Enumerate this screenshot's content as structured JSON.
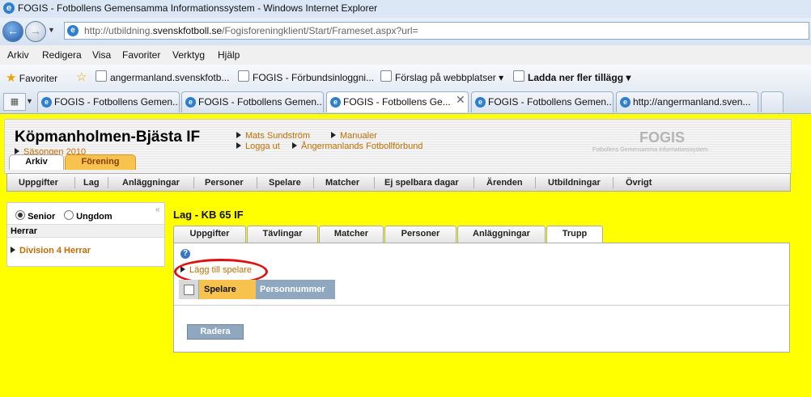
{
  "browser": {
    "title": "FOGIS - Fotbollens Gemensamma Informationssystem - Windows Internet Explorer",
    "address": {
      "prefix": "http://utbildning.",
      "domain": "svenskfotboll.se",
      "suffix": "/Fogisforeningklient/Start/Frameset.aspx?url="
    },
    "menu": [
      "Arkiv",
      "Redigera",
      "Visa",
      "Favoriter",
      "Verktyg",
      "Hjälp"
    ],
    "favorites": {
      "label": "Favoriter",
      "items": [
        "angermanland.svenskfotb...",
        "FOGIS - Förbundsinloggni...",
        "Förslag på webbplatser ▾",
        "Ladda ner fler tillägg ▾"
      ]
    },
    "tabs": [
      "FOGIS - Fotbollens Gemen...",
      "FOGIS - Fotbollens Gemen...",
      "FOGIS - Fotbollens Ge...",
      "FOGIS - Fotbollens Gemen...",
      "http://angermanland.sven..."
    ],
    "active_tab_index": 2
  },
  "header": {
    "club": "Köpmanholmen-Bjästa IF",
    "season": "Säsongen 2010",
    "links": [
      "Mats Sundström",
      "Manualer",
      "Logga ut",
      "Ångermanlands Fotbollförbund"
    ],
    "logo": "FOGIS",
    "logo_sub": "Fotbollens Gemensamma Informationssystem",
    "tabs": [
      "Arkiv",
      "Förening"
    ],
    "nav": [
      "Uppgifter",
      "Lag",
      "Anläggningar",
      "Personer",
      "Spelare",
      "Matcher",
      "Ej spelbara dagar",
      "Ärenden",
      "Utbildningar",
      "Övrigt"
    ]
  },
  "sidebar": {
    "radio_senior": "Senior",
    "radio_youth": "Ungdom",
    "selected": "Senior",
    "collapse": "«",
    "header": "Herrar",
    "items": [
      "Division 4 Herrar"
    ]
  },
  "main": {
    "title": "Lag - KB 65 IF",
    "tabs": [
      "Uppgifter",
      "Tävlingar",
      "Matcher",
      "Personer",
      "Anläggningar",
      "Trupp"
    ],
    "active_tab": "Trupp",
    "help": "?",
    "add_player": "Lägg till spelare",
    "columns": [
      "Spelare",
      "Personnummer"
    ],
    "delete_button": "Radera"
  }
}
